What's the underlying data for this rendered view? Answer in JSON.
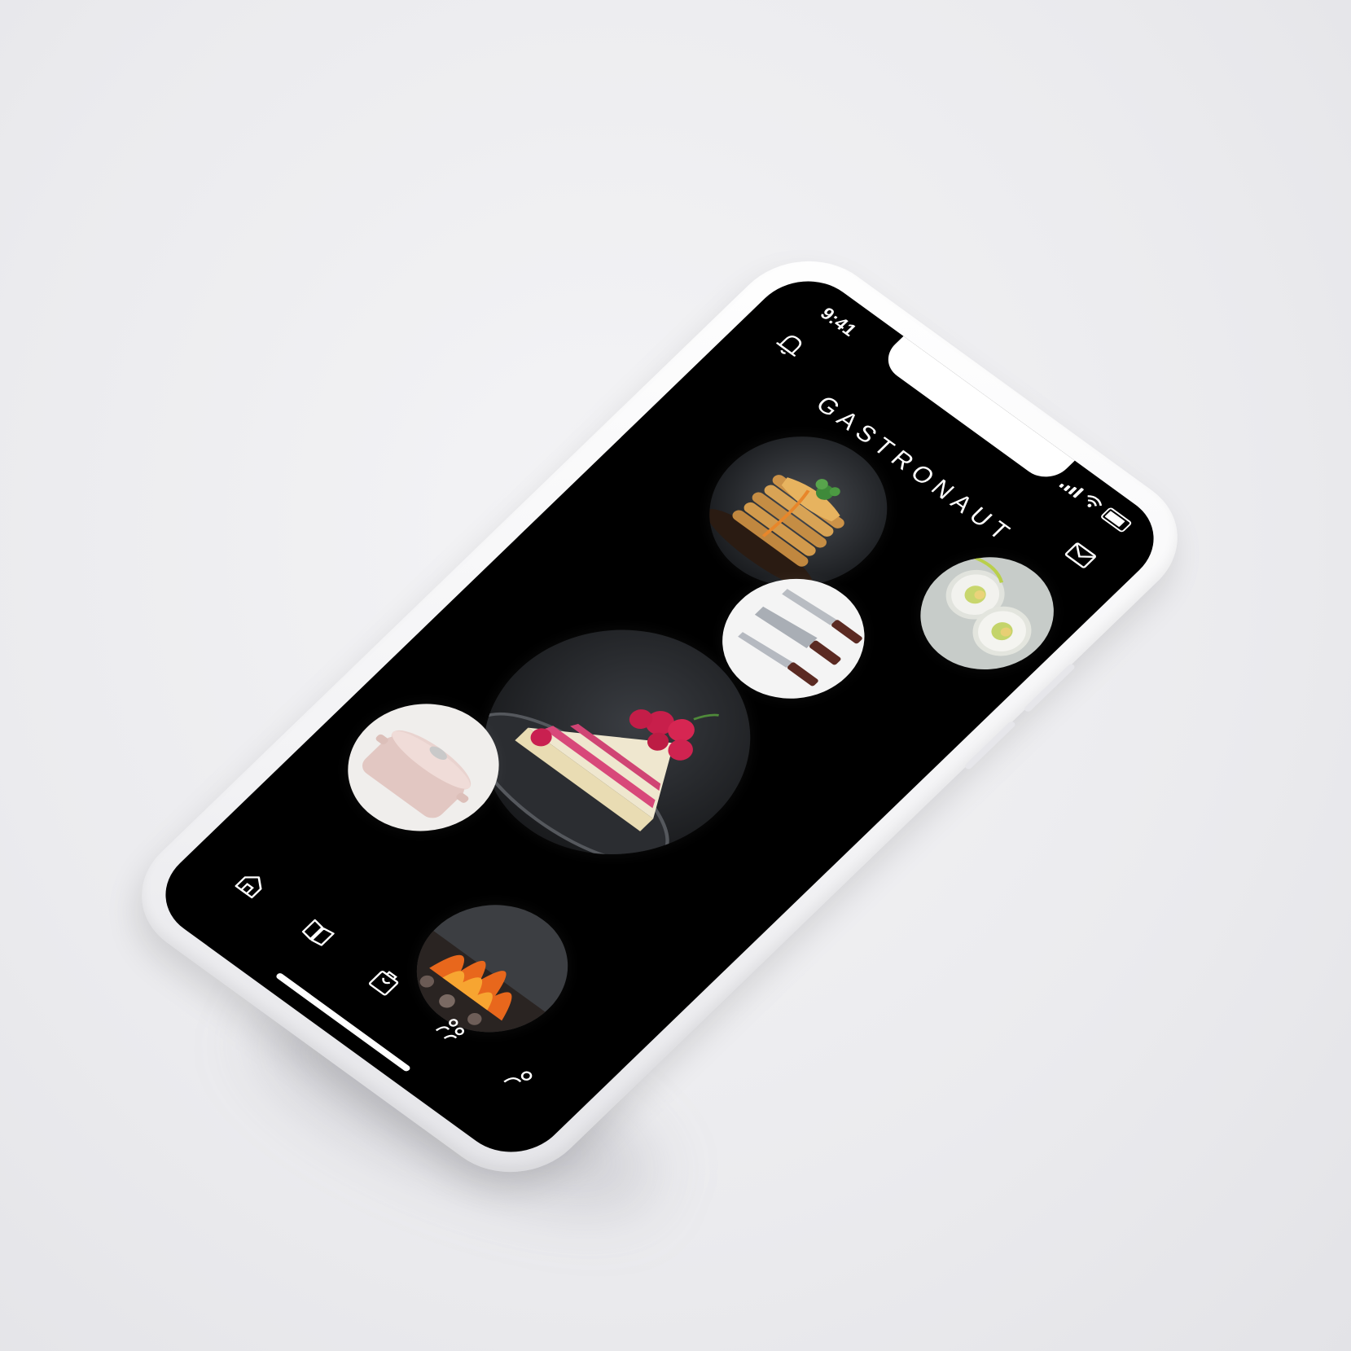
{
  "status_bar": {
    "time": "9:41"
  },
  "header": {
    "title": "GASTRONAUT",
    "left_icon": "bell-icon",
    "right_icon": "mail-icon"
  },
  "feed": {
    "items": [
      {
        "name": "pancakes",
        "icon": "pancake-stack-image"
      },
      {
        "name": "sushi",
        "icon": "sushi-roll-image"
      },
      {
        "name": "knives",
        "icon": "knife-set-image"
      },
      {
        "name": "raspberry-cake",
        "icon": "raspberry-cake-image"
      },
      {
        "name": "cooking-pot",
        "icon": "dutch-oven-image"
      },
      {
        "name": "grill-fire",
        "icon": "charcoal-fire-image"
      }
    ]
  },
  "tabbar": {
    "items": [
      {
        "name": "home",
        "icon": "home-icon"
      },
      {
        "name": "recipes",
        "icon": "book-icon"
      },
      {
        "name": "shop",
        "icon": "shopping-bag-icon"
      },
      {
        "name": "community",
        "icon": "people-icon"
      },
      {
        "name": "profile",
        "icon": "person-icon"
      }
    ]
  },
  "colors": {
    "screen_background": "#000000",
    "frame": "#f3f3f5",
    "foreground": "#ffffff"
  }
}
